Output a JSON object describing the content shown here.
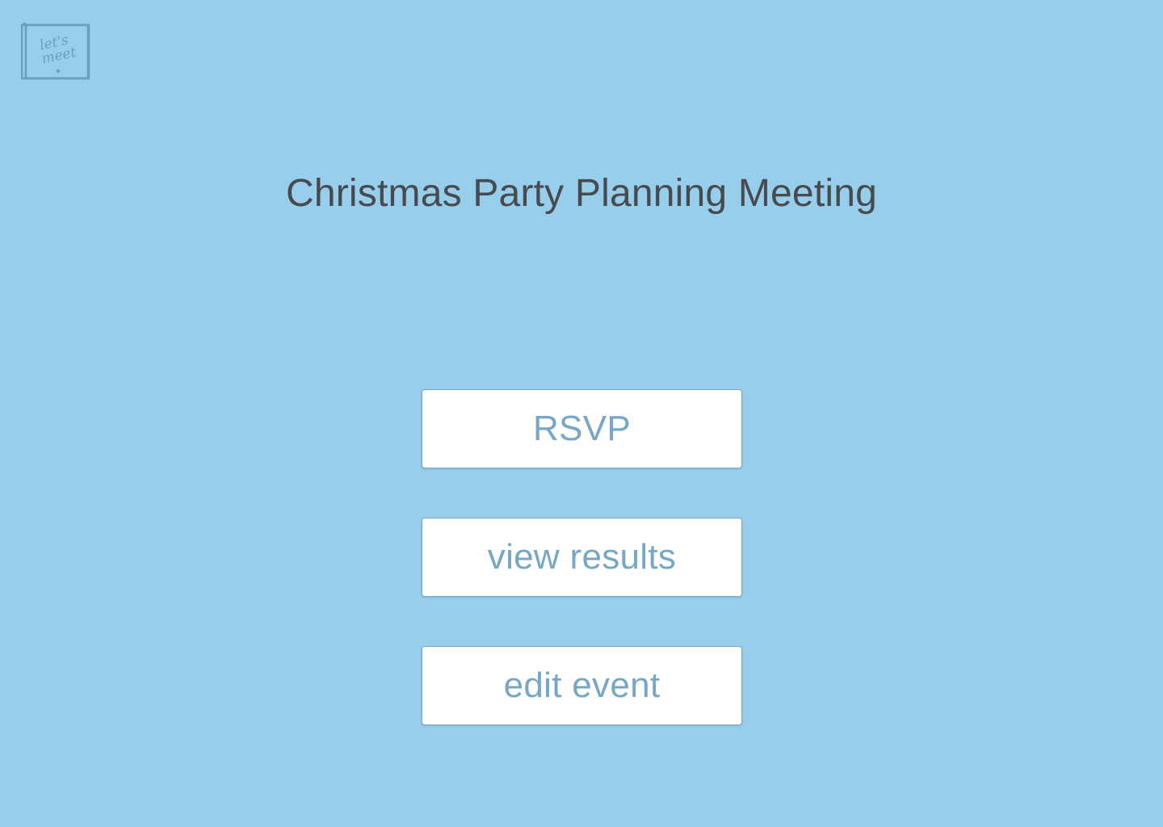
{
  "logo": {
    "line1": "let's",
    "line2": "meet"
  },
  "event": {
    "title": "Christmas Party Planning Meeting"
  },
  "actions": {
    "rsvp_label": "RSVP",
    "view_results_label": "view results",
    "edit_event_label": "edit event"
  },
  "colors": {
    "background": "#97ceec",
    "button_text": "#76a8c6",
    "title_text": "#474b4f",
    "logo": "#6a9ec0"
  }
}
